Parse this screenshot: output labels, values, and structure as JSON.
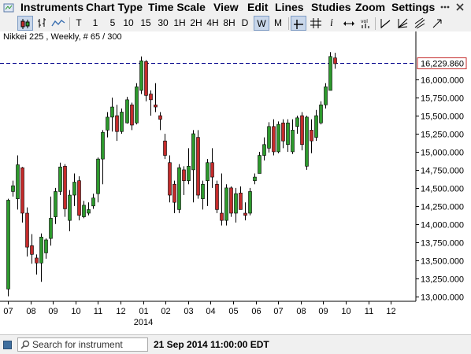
{
  "menu": {
    "items": [
      "Instruments",
      "Chart Type",
      "Time Scale",
      "View",
      "Edit",
      "Lines",
      "Studies",
      "Zoom",
      "Settings"
    ]
  },
  "toolbar": {
    "timeframes": [
      "T",
      "1",
      "5",
      "10",
      "15",
      "30",
      "1H",
      "2H",
      "4H",
      "8H",
      "D",
      "W",
      "M"
    ],
    "active_timeframe": "W",
    "icons": [
      "candlestick-icon",
      "bar-chart-icon",
      "line-chart-icon",
      "crosshair-icon",
      "grid-icon",
      "text-icon",
      "marker-icon",
      "scroll-icon",
      "volume-icon",
      "trend-line-icon",
      "fibonacci-icon",
      "pitchfork-icon",
      "more-tools-icon"
    ]
  },
  "chart": {
    "title": "Nikkei 225 , Weekly, # 65 / 300",
    "year_label": "2014",
    "last_price_label": "16,229.860",
    "colors": {
      "up": "#2d9a2d",
      "down": "#c42b2b",
      "wick": "#000000",
      "last_price_line": "#00008b",
      "label_border": "#c42b2b"
    }
  },
  "chart_data": {
    "type": "candlestick",
    "title": "Nikkei 225 , Weekly, # 65 / 300",
    "y_ticks": [
      13000,
      13250,
      13500,
      13750,
      14000,
      14250,
      14500,
      14750,
      15000,
      15250,
      15500,
      15750,
      16000
    ],
    "y_tick_labels": [
      "13,000.000",
      "13,250.000",
      "13,500.000",
      "13,750.000",
      "14,000.000",
      "14,250.000",
      "14,500.000",
      "14,750.000",
      "15,000.000",
      "15,250.000",
      "15,500.000",
      "15,750.000",
      "16,000.000"
    ],
    "ylim": [
      12930,
      16470
    ],
    "x_tick_labels": [
      "07",
      "08",
      "09",
      "10",
      "11",
      "12",
      "01",
      "02",
      "03",
      "04",
      "05",
      "06",
      "07",
      "08",
      "09",
      "10",
      "11",
      "12"
    ],
    "x_sub_label": "2014",
    "last_price": 16229.86,
    "last_price_label": "16,229.860",
    "candles": [
      {
        "o": 13100,
        "h": 14350,
        "l": 13000,
        "c": 14330
      },
      {
        "o": 14450,
        "h": 14600,
        "l": 14380,
        "c": 14530
      },
      {
        "o": 14350,
        "h": 14950,
        "l": 14200,
        "c": 14820
      },
      {
        "o": 14780,
        "h": 14790,
        "l": 14020,
        "c": 14150
      },
      {
        "o": 14150,
        "h": 14230,
        "l": 13550,
        "c": 13680
      },
      {
        "o": 13700,
        "h": 13860,
        "l": 13450,
        "c": 13580
      },
      {
        "o": 13530,
        "h": 13580,
        "l": 13300,
        "c": 13460
      },
      {
        "o": 13460,
        "h": 13870,
        "l": 13200,
        "c": 13820
      },
      {
        "o": 13600,
        "h": 13800,
        "l": 13520,
        "c": 13780
      },
      {
        "o": 13800,
        "h": 14380,
        "l": 13700,
        "c": 14080
      },
      {
        "o": 14100,
        "h": 14500,
        "l": 14000,
        "c": 14450
      },
      {
        "o": 14450,
        "h": 14850,
        "l": 14400,
        "c": 14790
      },
      {
        "o": 14800,
        "h": 14830,
        "l": 14100,
        "c": 14210
      },
      {
        "o": 14050,
        "h": 14470,
        "l": 13900,
        "c": 14400
      },
      {
        "o": 14400,
        "h": 14700,
        "l": 14250,
        "c": 14580
      },
      {
        "o": 14600,
        "h": 14660,
        "l": 14050,
        "c": 14120
      },
      {
        "o": 14100,
        "h": 14320,
        "l": 14080,
        "c": 14260
      },
      {
        "o": 14150,
        "h": 14300,
        "l": 14120,
        "c": 14200
      },
      {
        "o": 14250,
        "h": 14420,
        "l": 14210,
        "c": 14360
      },
      {
        "o": 14420,
        "h": 14920,
        "l": 14300,
        "c": 14900
      },
      {
        "o": 14900,
        "h": 15300,
        "l": 14550,
        "c": 15270
      },
      {
        "o": 15300,
        "h": 15550,
        "l": 15200,
        "c": 15480
      },
      {
        "o": 15480,
        "h": 15750,
        "l": 15280,
        "c": 15620
      },
      {
        "o": 15500,
        "h": 15650,
        "l": 15150,
        "c": 15280
      },
      {
        "o": 15280,
        "h": 15600,
        "l": 15250,
        "c": 15550
      },
      {
        "o": 15400,
        "h": 15760,
        "l": 15390,
        "c": 15720
      },
      {
        "o": 15650,
        "h": 15680,
        "l": 15300,
        "c": 15370
      },
      {
        "o": 15400,
        "h": 15950,
        "l": 15380,
        "c": 15900
      },
      {
        "o": 15850,
        "h": 16320,
        "l": 15800,
        "c": 16260
      },
      {
        "o": 16250,
        "h": 16270,
        "l": 15700,
        "c": 15780
      },
      {
        "o": 15800,
        "h": 15850,
        "l": 15500,
        "c": 15720
      },
      {
        "o": 15650,
        "h": 15950,
        "l": 15550,
        "c": 15620
      },
      {
        "o": 15500,
        "h": 15550,
        "l": 15300,
        "c": 15450
      },
      {
        "o": 15150,
        "h": 15250,
        "l": 14900,
        "c": 14950
      },
      {
        "o": 14850,
        "h": 14950,
        "l": 14300,
        "c": 14400
      },
      {
        "o": 14550,
        "h": 14600,
        "l": 14150,
        "c": 14300
      },
      {
        "o": 14200,
        "h": 14830,
        "l": 14150,
        "c": 14780
      },
      {
        "o": 14750,
        "h": 14800,
        "l": 14400,
        "c": 14600
      },
      {
        "o": 14600,
        "h": 15050,
        "l": 14550,
        "c": 14800
      },
      {
        "o": 14750,
        "h": 15300,
        "l": 14300,
        "c": 15250
      },
      {
        "o": 15200,
        "h": 15300,
        "l": 14350,
        "c": 14400
      },
      {
        "o": 14350,
        "h": 14600,
        "l": 14200,
        "c": 14550
      },
      {
        "o": 14600,
        "h": 14900,
        "l": 14250,
        "c": 14850
      },
      {
        "o": 14850,
        "h": 15050,
        "l": 14500,
        "c": 14650
      },
      {
        "o": 14550,
        "h": 14600,
        "l": 14150,
        "c": 14200
      },
      {
        "o": 14150,
        "h": 14700,
        "l": 13980,
        "c": 14050
      },
      {
        "o": 14050,
        "h": 14550,
        "l": 13980,
        "c": 14500
      },
      {
        "o": 14500,
        "h": 14520,
        "l": 14100,
        "c": 14150
      },
      {
        "o": 14150,
        "h": 14500,
        "l": 14020,
        "c": 14420
      },
      {
        "o": 14430,
        "h": 14520,
        "l": 14280,
        "c": 14200
      },
      {
        "o": 14150,
        "h": 14300,
        "l": 14050,
        "c": 14120
      },
      {
        "o": 14150,
        "h": 14500,
        "l": 14120,
        "c": 14450
      },
      {
        "o": 14600,
        "h": 14700,
        "l": 14550,
        "c": 14650
      },
      {
        "o": 14700,
        "h": 15000,
        "l": 14700,
        "c": 14950
      },
      {
        "o": 14950,
        "h": 15200,
        "l": 14880,
        "c": 15100
      },
      {
        "o": 15050,
        "h": 15410,
        "l": 14990,
        "c": 15350
      },
      {
        "o": 15350,
        "h": 15450,
        "l": 14950,
        "c": 15000
      },
      {
        "o": 15000,
        "h": 15420,
        "l": 14980,
        "c": 15380
      },
      {
        "o": 15400,
        "h": 15450,
        "l": 15050,
        "c": 15150
      },
      {
        "o": 15100,
        "h": 15450,
        "l": 15000,
        "c": 15400
      },
      {
        "o": 15000,
        "h": 15450,
        "l": 14970,
        "c": 15300
      },
      {
        "o": 15350,
        "h": 15500,
        "l": 15250,
        "c": 15470
      },
      {
        "o": 15500,
        "h": 15550,
        "l": 15020,
        "c": 15100
      },
      {
        "o": 14800,
        "h": 15500,
        "l": 14750,
        "c": 15480
      },
      {
        "o": 15300,
        "h": 15450,
        "l": 14980,
        "c": 15150
      },
      {
        "o": 15200,
        "h": 15580,
        "l": 15150,
        "c": 15500
      },
      {
        "o": 15400,
        "h": 15700,
        "l": 15380,
        "c": 15650
      },
      {
        "o": 15650,
        "h": 15950,
        "l": 15600,
        "c": 15900
      },
      {
        "o": 15850,
        "h": 16380,
        "l": 15850,
        "c": 16320
      },
      {
        "o": 16300,
        "h": 16370,
        "l": 16150,
        "c": 16220
      }
    ]
  },
  "statusbar": {
    "search_placeholder": "Search for instrument",
    "datetime": "21 Sep 2014 11:00:00 EDT"
  }
}
